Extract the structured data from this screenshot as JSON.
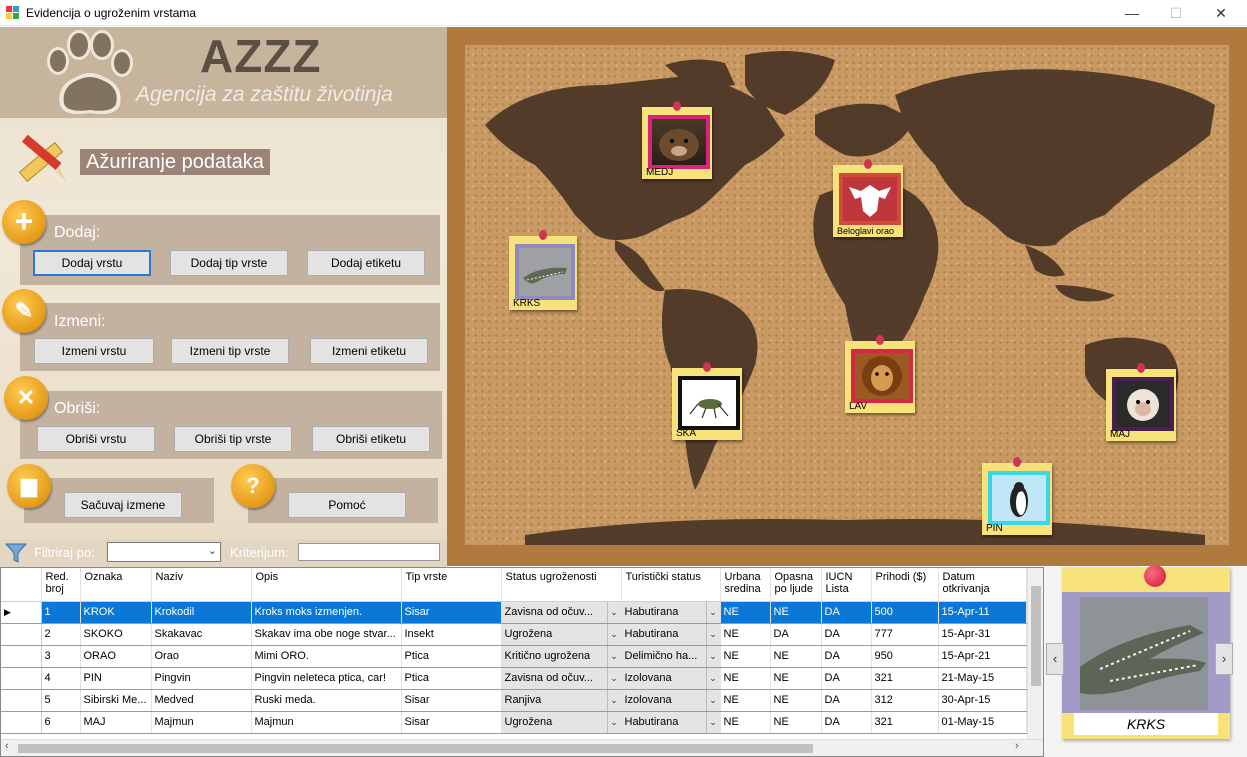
{
  "window": {
    "title": "Evidencija o ugroženim vrstama",
    "minimize_glyph": "—",
    "maximize_glyph": "☐",
    "close_glyph": "✕"
  },
  "header": {
    "logo_title": "AZZZ",
    "logo_subtitle": "Agencija za zaštitu životinja",
    "section_title": "Ažuriranje podataka"
  },
  "actions": {
    "add": {
      "label": "Dodaj:",
      "buttons": [
        "Dodaj vrstu",
        "Dodaj tip vrste",
        "Dodaj etiketu"
      ]
    },
    "edit": {
      "label": "Izmeni:",
      "buttons": [
        "Izmeni vrstu",
        "Izmeni tip vrste",
        "Izmeni etiketu"
      ]
    },
    "delete": {
      "label": "Obriši:",
      "buttons": [
        "Obriši vrstu",
        "Obriši tip vrste",
        "Obriši etiketu"
      ]
    },
    "save_label": "Sačuvaj izmene",
    "help_label": "Pomoć"
  },
  "filter": {
    "label": "Filtriraj po:",
    "criteria_label": "Kriterijum:",
    "selected": "",
    "criteria_value": ""
  },
  "map_notes": [
    {
      "label": "MEDJ",
      "frame_color": "#d8257a"
    },
    {
      "label": "Beloglavi orao",
      "frame_color": "#d24a3a"
    },
    {
      "label": "KRKS",
      "frame_color": "#8f8ac0"
    },
    {
      "label": "SKA",
      "frame_color": "#111111"
    },
    {
      "label": "LAV",
      "frame_color": "#d8254a"
    },
    {
      "label": "MAJ",
      "frame_color": "#4a1f4f"
    },
    {
      "label": "PIN",
      "frame_color": "#39d6e6"
    }
  ],
  "table": {
    "columns": [
      "Red. broj",
      "Oznaka",
      "Naziv",
      "Opis",
      "Tip vrste",
      "Status ugroženosti",
      "Turistički status",
      "Urbana sredina",
      "Opasna po ljude",
      "IUCN Lista",
      "Prihodi ($)",
      "Datum otkrivanja"
    ],
    "rows": [
      [
        "1",
        "KROK",
        "Krokodil",
        "Kroks moks izmenjen.",
        "Sisar",
        "Zavisna od očuv...",
        "Habutirana",
        "NE",
        "NE",
        "DA",
        "500",
        "15-Apr-11"
      ],
      [
        "2",
        "SKOKO",
        "Skakavac",
        "Skakav ima obe noge stvar...",
        "Insekt",
        "Ugrožena",
        "Habutirana",
        "NE",
        "DA",
        "DA",
        "777",
        "15-Apr-31"
      ],
      [
        "3",
        "ORAO",
        "Orao",
        "Mimi ORO.",
        "Ptica",
        "Kritično ugrožena",
        "Delimično ha...",
        "NE",
        "NE",
        "DA",
        "950",
        "15-Apr-21"
      ],
      [
        "4",
        "PIN",
        "Pingvin",
        "Pingvin neleteca ptica, car!",
        "Ptica",
        "Zavisna od očuv...",
        "Izolovana",
        "NE",
        "NE",
        "DA",
        "321",
        "21-May-15"
      ],
      [
        "5",
        "Sibirski Me...",
        "Medved",
        "Ruski meda.",
        "Sisar",
        "Ranjiva",
        "Izolovana",
        "NE",
        "NE",
        "DA",
        "312",
        "30-Apr-15"
      ],
      [
        "6",
        "MAJ",
        "Majmun",
        "Majmun",
        "Sisar",
        "Ugrožena",
        "Habutirana",
        "NE",
        "NE",
        "DA",
        "321",
        "01-May-15"
      ]
    ],
    "selected_row": 0
  },
  "preview": {
    "caption": "KRKS",
    "prev_glyph": "‹",
    "next_glyph": "›"
  },
  "colors": {
    "selection": "#0a78d7",
    "note_yellow": "#f8e27a",
    "icon_orange": "#e59a17"
  }
}
